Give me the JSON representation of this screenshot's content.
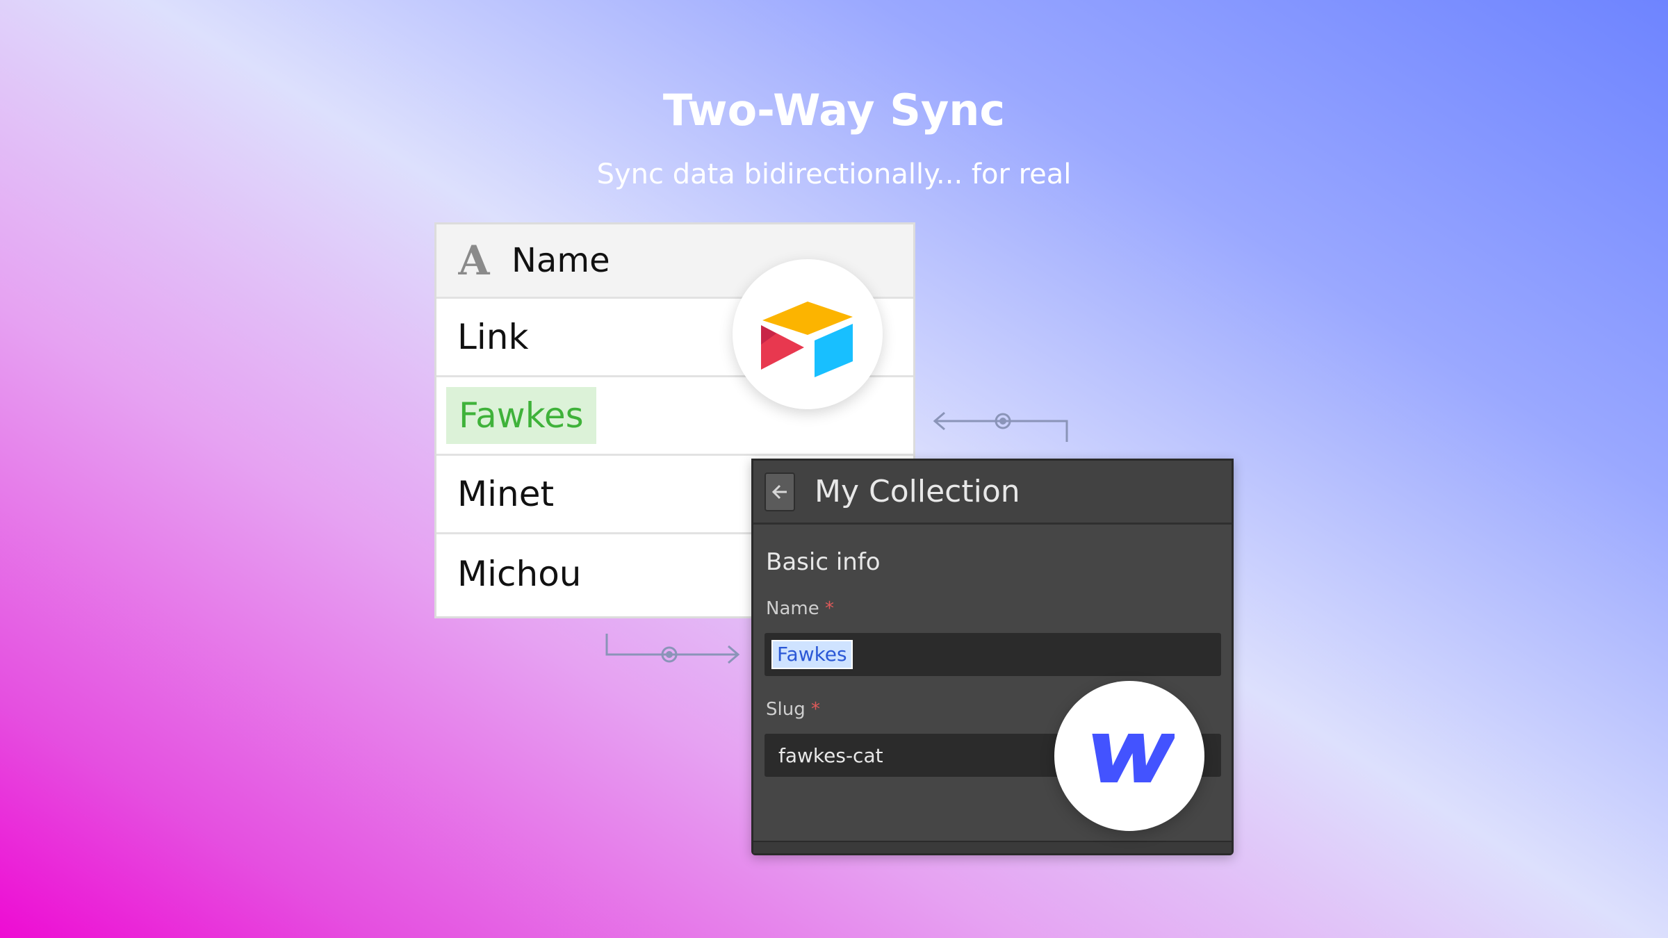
{
  "hero": {
    "title": "Two-Way Sync",
    "subtitle": "Sync data bidirectionally... for real"
  },
  "airtable": {
    "header_icon": "text-field-icon",
    "header_label": "Name",
    "rows": [
      {
        "label": "Link",
        "highlighted": false
      },
      {
        "label": "Fawkes",
        "highlighted": true
      },
      {
        "label": "Minet",
        "highlighted": false
      },
      {
        "label": "Michou",
        "highlighted": false
      }
    ],
    "logo_icon": "airtable-logo-icon",
    "logo_colors": {
      "yellow": "#fcb400",
      "red": "#e8384f",
      "blue": "#18bfff"
    }
  },
  "webflow": {
    "back_icon": "arrow-left-icon",
    "panel_title": "My Collection",
    "section_label": "Basic info",
    "name_label": "Name",
    "name_required": "*",
    "name_value": "Fawkes",
    "slug_label": "Slug",
    "slug_required": "*",
    "slug_value": "fawkes-cat",
    "logo_icon": "webflow-logo-icon",
    "logo_color": "#4353ff"
  },
  "sync_arrows": {
    "to_webflow_icon": "arrow-right-icon",
    "to_airtable_icon": "arrow-left-icon",
    "color": "#8a94b8"
  }
}
